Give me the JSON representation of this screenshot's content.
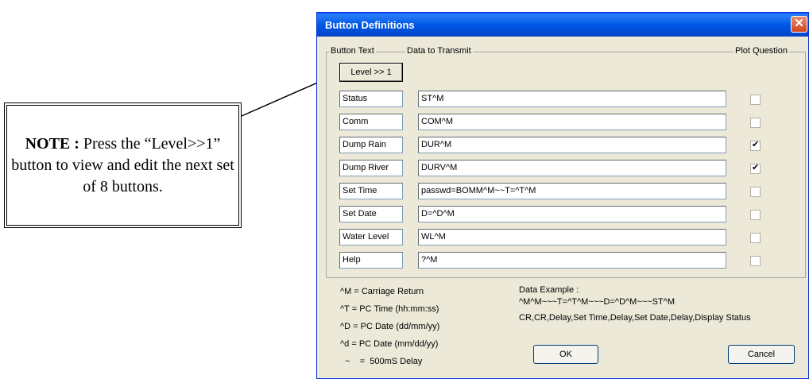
{
  "note": {
    "bold": "NOTE :",
    "text": " Press the “Level>>1” button to view and edit the next set of 8 buttons."
  },
  "dialog": {
    "title": "Button Definitions",
    "close_label": "✕",
    "headers": {
      "button_text": "Button Text",
      "data_to_transmit": "Data to Transmit",
      "plot_question": "Plot Question"
    },
    "level_button": "Level >> 1",
    "rows": [
      {
        "button_text": "Status",
        "data": "ST^M",
        "plot": false
      },
      {
        "button_text": "Comm",
        "data": "COM^M",
        "plot": false
      },
      {
        "button_text": "Dump Rain",
        "data": "DUR^M",
        "plot": true
      },
      {
        "button_text": "Dump River",
        "data": "DURV^M",
        "plot": true
      },
      {
        "button_text": "Set Time",
        "data": "passwd=BOMM^M~~T=^T^M",
        "plot": false
      },
      {
        "button_text": "Set Date",
        "data": "D=^D^M",
        "plot": false
      },
      {
        "button_text": "Water Level",
        "data": "WL^M",
        "plot": false
      },
      {
        "button_text": "Help",
        "data": "?^M",
        "plot": false
      }
    ],
    "legend_notes": [
      "^M  =  Carriage Return",
      "^T   =  PC Time (hh:mm:ss)",
      "^D   =  PC Date (dd/mm/yy)",
      "^d   =  PC Date (mm/dd/yy)",
      "  ~    =  500mS Delay"
    ],
    "example": {
      "label": "Data Example :",
      "value": "^M^M~~~T=^T^M~~~D=^D^M~~~ST^M",
      "description": "CR,CR,Delay,Set Time,Delay,Set Date,Delay,Display Status"
    },
    "ok_label": "OK",
    "cancel_label": "Cancel"
  }
}
